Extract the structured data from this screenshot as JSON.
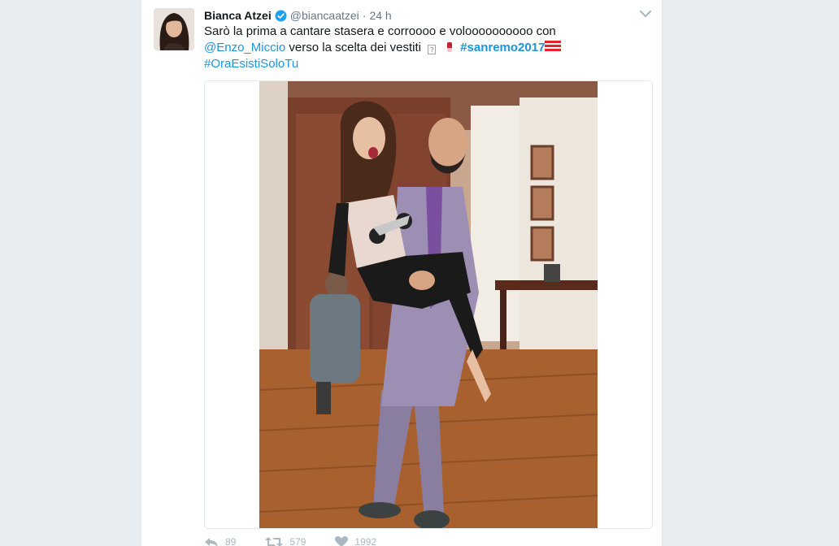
{
  "tweet": {
    "fullname": "Bianca Atzei",
    "username": "@biancaatzei",
    "separator": "·",
    "time": "24 h",
    "text_line1": "Sarò la prima a cantare stasera e corroooo e voloooooooooo con",
    "mention": "@Enzo_Miccio",
    "text_line2": " verso la scelta dei vestiti ",
    "emoji_box_glyph": "?",
    "hashtag_main": "#sanremo2017",
    "hashtag_second": "#OraEsistiSoloTu"
  },
  "actions": {
    "reply_count": "89",
    "retweet_count": "579",
    "like_count": "1992"
  },
  "icons": {
    "verified": "verified-badge-icon",
    "chevron": "chevron-down-icon",
    "reply": "reply-icon",
    "retweet": "retweet-icon",
    "like": "heart-icon"
  },
  "colors": {
    "link": "#1b95e0",
    "verified": "#1da1f2",
    "text": "#14171a",
    "meta": "#657786"
  }
}
